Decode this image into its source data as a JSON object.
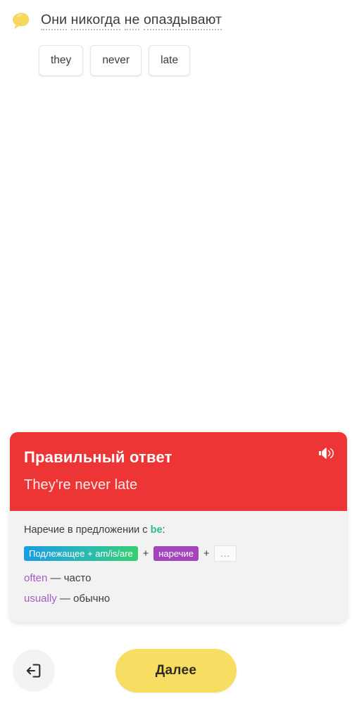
{
  "prompt": {
    "icon": "speech-bubble-icon",
    "words": [
      "Они",
      "никогда",
      "не",
      "опаздывают"
    ]
  },
  "word_bank": {
    "tiles": [
      {
        "label": "they"
      },
      {
        "label": "never"
      },
      {
        "label": "late"
      }
    ]
  },
  "answer_card": {
    "title": "Правильный ответ",
    "sentence": "They're never late",
    "speaker_icon": "speaker-icon",
    "accent_color": "#ee3535",
    "explanation": {
      "rule_prefix": "Наречие в предложении с ",
      "rule_keyword": "be",
      "rule_suffix": ":",
      "formula": {
        "subject_chip": "Подлежащее + am/is/are",
        "plus_1": "+",
        "adverb_chip": "наречие",
        "plus_2": "+",
        "rest_chip": "...",
        "subject_chip_colors": [
          "#1b9ce4",
          "#36cf6f"
        ],
        "adverb_chip_color": "#a445bb"
      },
      "vocab": [
        {
          "en": "often",
          "dash": " — ",
          "ru": "часто"
        },
        {
          "en": "usually",
          "dash": " — ",
          "ru": "обычно"
        }
      ],
      "vocab_color": "#a45bc4",
      "keyword_color": "#2ec27e"
    }
  },
  "bottom_bar": {
    "exit_icon": "exit-door-icon",
    "next_label": "Далее",
    "next_color": "#f7dd62"
  }
}
